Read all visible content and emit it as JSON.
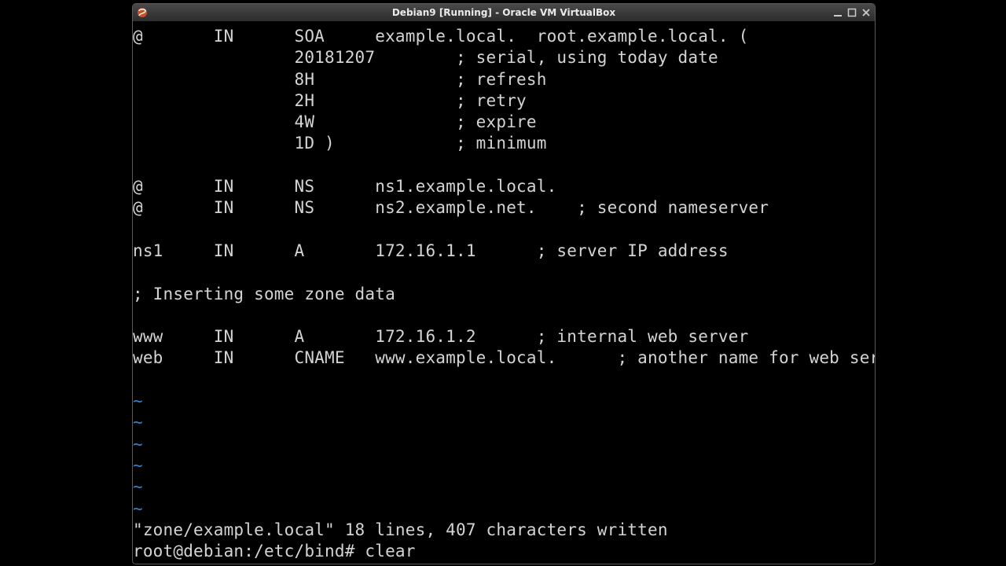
{
  "window": {
    "title": "Debian9 [Running] - Oracle VM VirtualBox"
  },
  "terminal": {
    "lines": [
      "@       IN      SOA     example.local.  root.example.local. (",
      "                20181207        ; serial, using today date",
      "                8H              ; refresh",
      "                2H              ; retry",
      "                4W              ; expire",
      "                1D )            ; minimum",
      "",
      "@       IN      NS      ns1.example.local.",
      "@       IN      NS      ns2.example.net.    ; second nameserver",
      "",
      "ns1     IN      A       172.16.1.1      ; server IP address",
      "",
      "; Inserting some zone data",
      "",
      "www     IN      A       172.16.1.2      ; internal web server",
      "web     IN      CNAME   www.example.local.      ; another name for web server",
      "",
      "~",
      "~",
      "~",
      "~",
      "~",
      "~",
      "\"zone/example.local\" 18 lines, 407 characters written",
      "root@debian:/etc/bind# clear"
    ]
  }
}
